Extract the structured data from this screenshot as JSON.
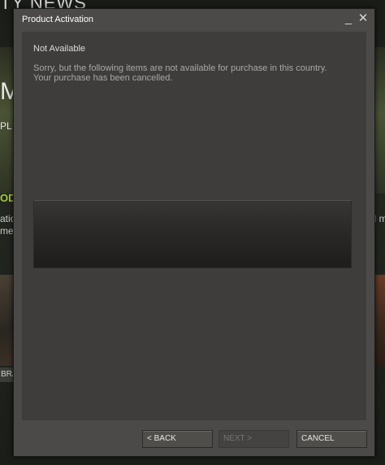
{
  "background": {
    "nav_text": "TY  NEWS",
    "banner_letter": "M",
    "banner_sub": "PL",
    "highlight": "OD",
    "text_lines": [
      "atic",
      "me"
    ],
    "right_text": "ll m",
    "badge": "BRA"
  },
  "dialog": {
    "title": "Product Activation",
    "minimize_glyph": "_",
    "close_glyph": "✕",
    "heading": "Not Available",
    "message": "Sorry, but the following items are not available for purchase in this country. Your purchase has been cancelled.",
    "buttons": {
      "back": "< BACK",
      "next": "NEXT >",
      "cancel": "CANCEL"
    }
  }
}
